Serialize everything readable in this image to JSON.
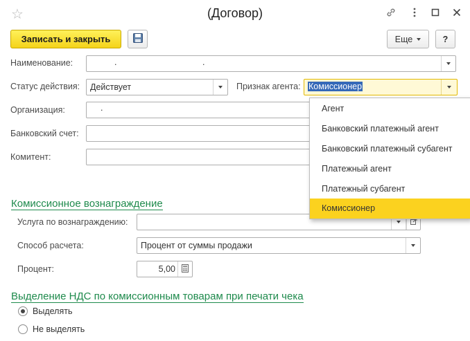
{
  "window": {
    "title": "(Договор)"
  },
  "toolbar": {
    "save_close_label": "Записать и закрыть",
    "more_label": "Еще",
    "help_label": "?"
  },
  "form": {
    "name_label": "Наименование:",
    "name_value": ". .",
    "status_label": "Статус действия:",
    "status_value": "Действует",
    "agent_sign_label": "Признак агента:",
    "agent_sign_value": "Комиссионер",
    "org_label": "Организация:",
    "org_value": ".",
    "bank_label": "Банковский счет:",
    "bank_value": "",
    "principal_label": "Комитент:",
    "principal_value": ""
  },
  "commission": {
    "section_title": "Комиссионное вознаграждение",
    "service_label": "Услуга по вознаграждению:",
    "service_value": "",
    "calc_label": "Способ расчета:",
    "calc_value": "Процент от суммы продажи",
    "percent_label": "Процент:",
    "percent_value": "5,00"
  },
  "vat": {
    "section_title": "Выделение НДС по комиссионным товарам при печати чека",
    "options": [
      {
        "label": "Выделять",
        "selected": true
      },
      {
        "label": "Не выделять",
        "selected": false
      }
    ]
  },
  "agent_dropdown": {
    "items": [
      "Агент",
      "Банковский платежный агент",
      "Банковский платежный субагент",
      "Платежный агент",
      "Платежный субагент",
      "Комиссионер"
    ],
    "selected_index": 5
  },
  "colors": {
    "primary_button": "#f4d31a",
    "link_green": "#1e8a4c",
    "selection_yellow": "#fbd21f",
    "text_highlight": "#3569b8"
  }
}
